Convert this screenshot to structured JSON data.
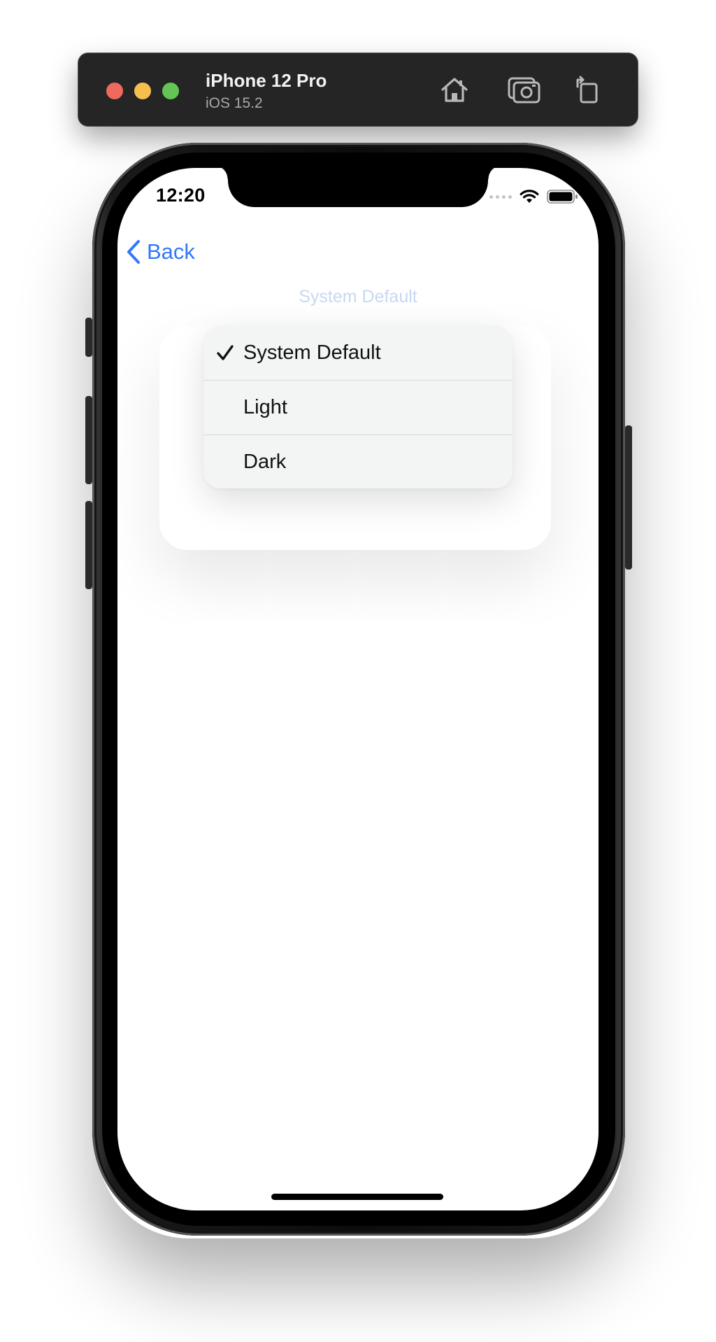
{
  "simulator": {
    "device_name": "iPhone 12 Pro",
    "os_version": "iOS 15.2",
    "traffic_lights": {
      "close_color": "#ee6a5f",
      "minimize_color": "#f5be4f",
      "maximize_color": "#62c554"
    },
    "toolbar_icons": [
      "home-icon",
      "screenshot-camera-icon",
      "rotate-icon"
    ]
  },
  "status_bar": {
    "time": "12:20",
    "icons": [
      "cellular-signal-icon",
      "wifi-icon",
      "battery-icon"
    ]
  },
  "nav": {
    "back_label": "Back",
    "accent_color": "#3478f6"
  },
  "picker": {
    "current_value": "System Default"
  },
  "menu": {
    "items": [
      {
        "label": "System Default",
        "selected": true
      },
      {
        "label": "Light",
        "selected": false
      },
      {
        "label": "Dark",
        "selected": false
      }
    ]
  }
}
